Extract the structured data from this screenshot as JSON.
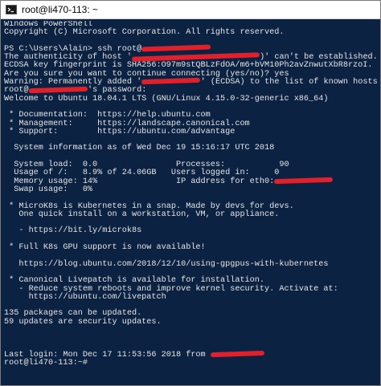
{
  "window": {
    "title": "root@li470-113: ~",
    "icon": "terminal-icon"
  },
  "colors": {
    "background": "#0c2242",
    "text": "#e6e6e6",
    "redaction": "#e0202a"
  },
  "terminal": {
    "lines": [
      {
        "text": "Windows PowerShell"
      },
      {
        "text": "Copyright (C) Microsoft Corporation. All rights reserved."
      },
      {
        "text": ""
      },
      {
        "text": "PS C:\\Users\\Alain> ssh root@",
        "redact": 14,
        "after": ""
      },
      {
        "text": "The authenticity of host '",
        "redact": 26,
        "after": ")' can't be established."
      },
      {
        "text": "ECDSA key fingerprint is SHA256:O97m9stQBLzFdOA/m6+bVM10Ph2avZnwutXbR8rzoI."
      },
      {
        "text": "Are you sure you want to continue connecting (yes/no)? yes"
      },
      {
        "text": "Warning: Permanently added '",
        "redact": 12,
        "after": "' (ECDSA) to the list of known hosts."
      },
      {
        "text": "root@",
        "redact": 12,
        "after": "'s password:"
      },
      {
        "text": "Welcome to Ubuntu 18.04.1 LTS (GNU/Linux 4.15.0-32-generic x86_64)"
      },
      {
        "text": ""
      },
      {
        "text": " * Documentation:  https://help.ubuntu.com"
      },
      {
        "text": " * Management:     https://landscape.canonical.com"
      },
      {
        "text": " * Support:        https://ubuntu.com/advantage"
      },
      {
        "text": ""
      },
      {
        "text": "  System information as of Wed Dec 19 15:16:17 UTC 2018"
      },
      {
        "text": ""
      },
      {
        "text": "  System load:  0.0                Processes:           90"
      },
      {
        "text": "  Usage of /:   8.9% of 24.06GB   Users logged in:     0"
      },
      {
        "text": "  Memory usage: 14%                IP address for eth0:",
        "redact": 12,
        "after": ""
      },
      {
        "text": "  Swap usage:   0%"
      },
      {
        "text": ""
      },
      {
        "text": " * MicroK8s is Kubernetes in a snap. Made by devs for devs."
      },
      {
        "text": "   One quick install on a workstation, VM, or appliance."
      },
      {
        "text": ""
      },
      {
        "text": "   - https://bit.ly/microk8s"
      },
      {
        "text": ""
      },
      {
        "text": " * Full K8s GPU support is now available!"
      },
      {
        "text": ""
      },
      {
        "text": "   https://blog.ubuntu.com/2018/12/10/using-gpgpus-with-kubernetes"
      },
      {
        "text": ""
      },
      {
        "text": " * Canonical Livepatch is available for installation."
      },
      {
        "text": "   - Reduce system reboots and improve kernel security. Activate at:"
      },
      {
        "text": "     https://ubuntu.com/livepatch"
      },
      {
        "text": ""
      },
      {
        "text": "135 packages can be updated."
      },
      {
        "text": "59 updates are security updates."
      },
      {
        "text": ""
      },
      {
        "text": ""
      },
      {
        "text": ""
      },
      {
        "text": "Last login: Mon Dec 17 11:53:56 2018 from ",
        "redact": 11,
        "after": ""
      },
      {
        "text": "root@li470-113:~#"
      }
    ]
  }
}
